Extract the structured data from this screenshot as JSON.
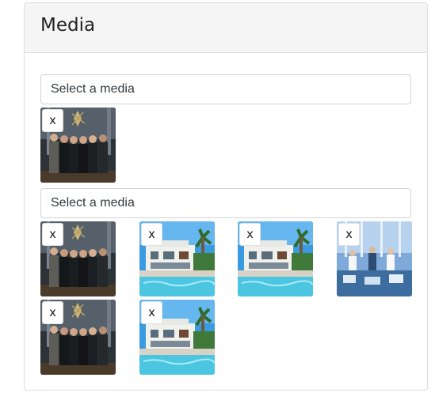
{
  "panel": {
    "title": "Media"
  },
  "pickers": [
    {
      "placeholder": "Select a media",
      "items": [
        {
          "image": "team-photo",
          "remove_label": "x"
        }
      ]
    },
    {
      "placeholder": "Select a media",
      "items": [
        {
          "image": "team-photo",
          "remove_label": "x"
        },
        {
          "image": "villa-pool-photo",
          "remove_label": "x"
        },
        {
          "image": "villa-pool-photo",
          "remove_label": "x"
        },
        {
          "image": "office-meeting-photo",
          "remove_label": "x"
        },
        {
          "image": "team-photo",
          "remove_label": "x"
        },
        {
          "image": "villa-pool-photo",
          "remove_label": "x"
        }
      ]
    }
  ],
  "colors": {
    "header_bg": "#f5f5f5",
    "border": "#dcdcdc",
    "input_border": "#d0d4d8"
  }
}
